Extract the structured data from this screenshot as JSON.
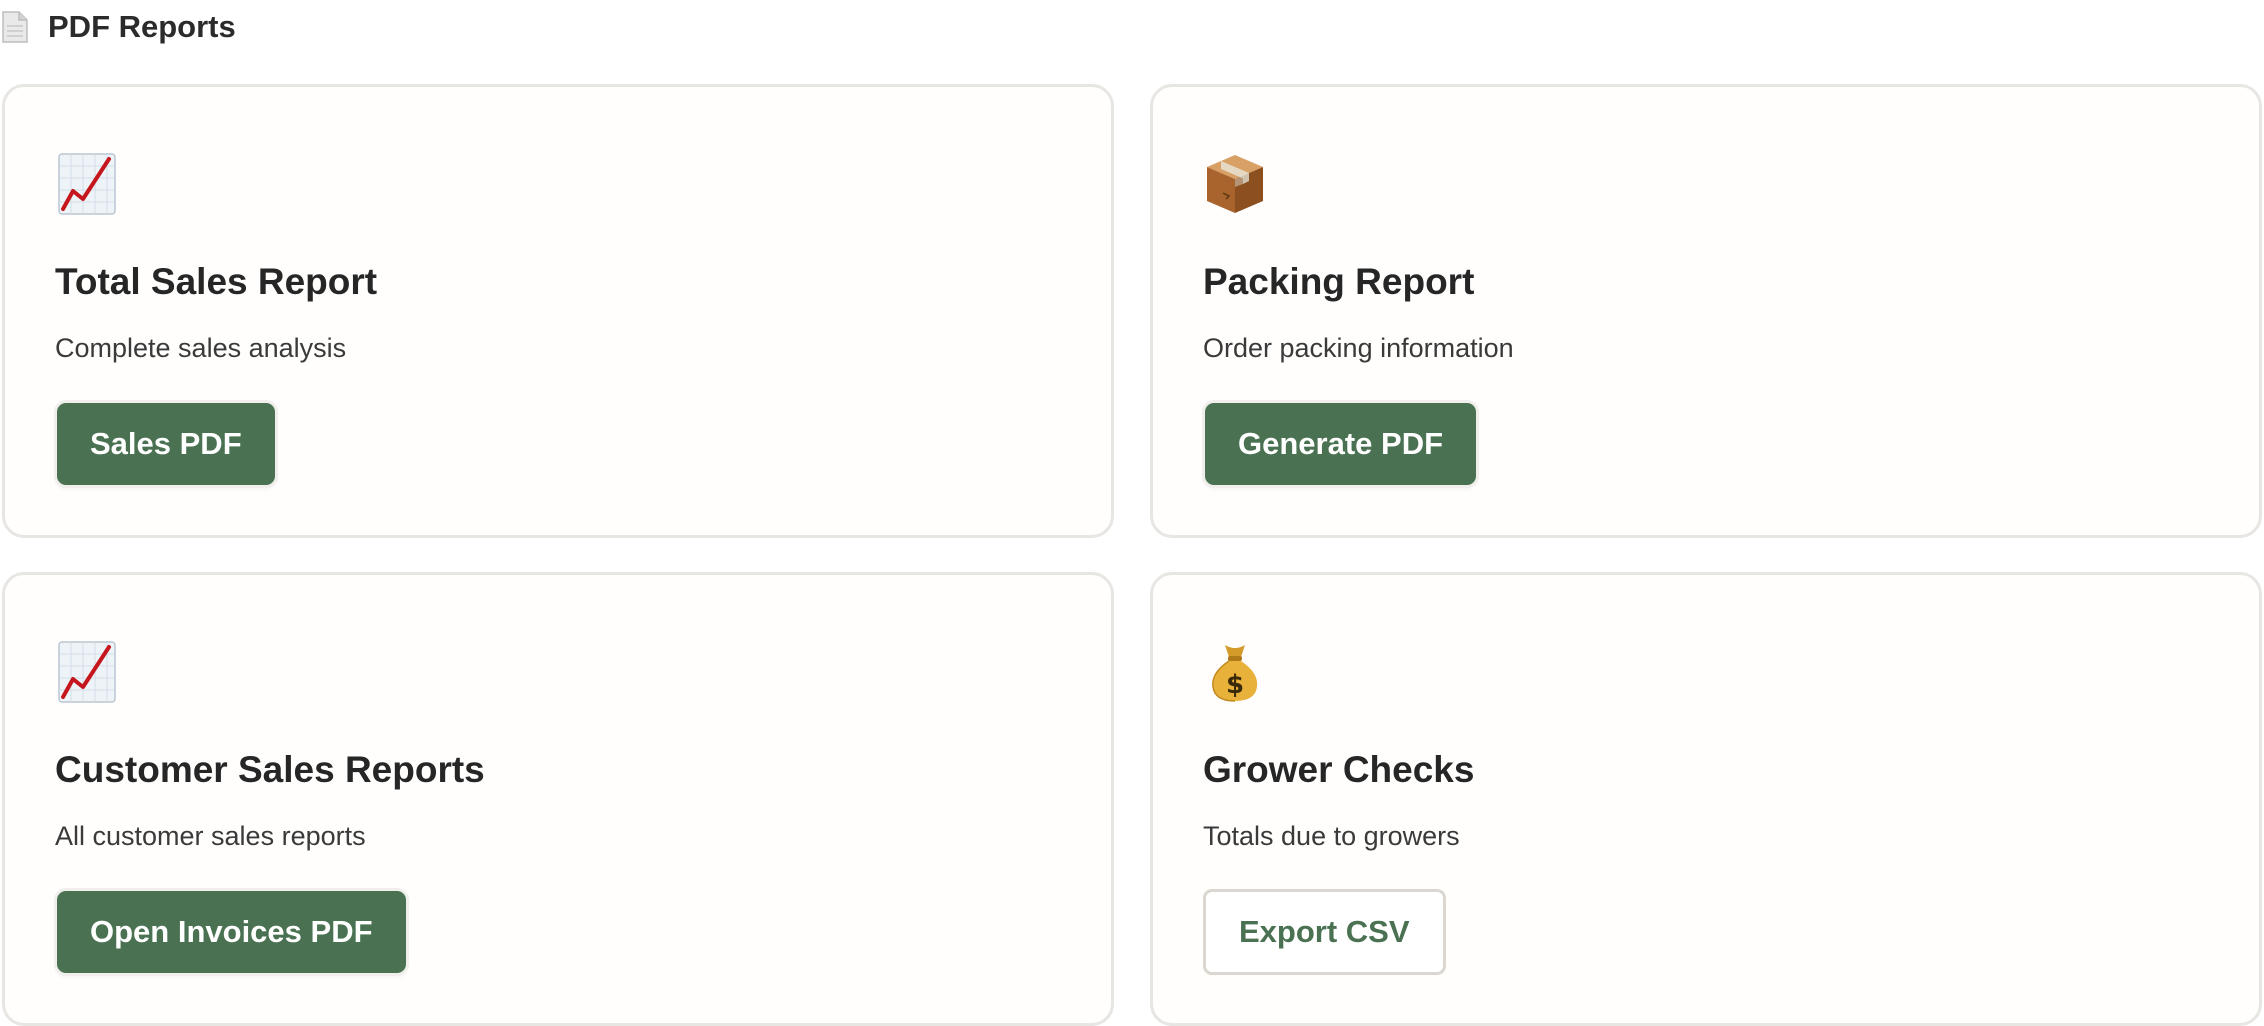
{
  "header": {
    "icon": "page-facing-up-icon",
    "title": "PDF Reports"
  },
  "cards": [
    {
      "icon": "chart-increasing-icon",
      "title": "Total Sales Report",
      "description": "Complete sales analysis",
      "button_label": "Sales PDF",
      "button_style": "primary"
    },
    {
      "icon": "package-icon",
      "title": "Packing Report",
      "description": "Order packing information",
      "button_label": "Generate PDF",
      "button_style": "primary"
    },
    {
      "icon": "chart-increasing-icon",
      "title": "Customer Sales Reports",
      "description": "All customer sales reports",
      "button_label": "Open Invoices PDF",
      "button_style": "primary"
    },
    {
      "icon": "money-bag-icon",
      "title": "Grower Checks",
      "description": "Totals due to growers",
      "button_label": "Export CSV",
      "button_style": "outline"
    }
  ],
  "colors": {
    "accent_green": "#4a7252",
    "card_border": "#e8e6e3",
    "outline_border": "#dcd6d0"
  }
}
